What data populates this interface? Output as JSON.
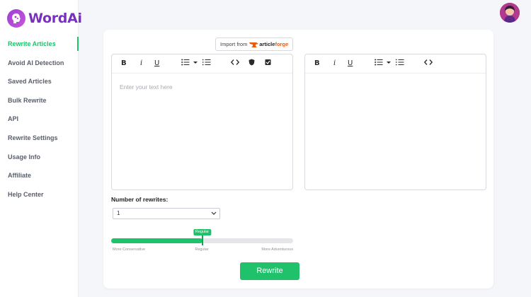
{
  "brand": {
    "name": "WordAi",
    "accent": "#20c16b",
    "brand_color": "#7b2fbe"
  },
  "sidebar": {
    "items": [
      {
        "label": "Rewrite Articles",
        "active": true
      },
      {
        "label": "Avoid AI Detection",
        "active": false
      },
      {
        "label": "Saved Articles",
        "active": false
      },
      {
        "label": "Bulk Rewrite",
        "active": false
      },
      {
        "label": "API",
        "active": false
      },
      {
        "label": "Rewrite Settings",
        "active": false
      },
      {
        "label": "Usage Info",
        "active": false
      },
      {
        "label": "Affiliate",
        "active": false
      },
      {
        "label": "Help Center",
        "active": false
      }
    ]
  },
  "import": {
    "prefix": "Import from",
    "brand_a": "article",
    "brand_b": "forge"
  },
  "editor_left": {
    "placeholder": "Enter your text here",
    "toolbar_icons": [
      "bold-icon",
      "italic-icon",
      "underline-icon",
      "bulleted-list-icon",
      "dropdown-caret-icon",
      "numbered-list-icon",
      "code-icon",
      "shield-icon",
      "check-box-icon"
    ]
  },
  "editor_right": {
    "toolbar_icons": [
      "bold-icon",
      "italic-icon",
      "underline-icon",
      "bulleted-list-icon",
      "dropdown-caret-icon",
      "numbered-list-icon",
      "code-icon"
    ]
  },
  "toolbar_glyphs": {
    "bold": "B",
    "italic": "i",
    "underline": "U"
  },
  "rewrites": {
    "label": "Number of rewrites:",
    "value": "1"
  },
  "slider": {
    "tag": "Regular",
    "position_fraction": 0.5,
    "labels": {
      "left": "More Conservative",
      "middle": "Regular",
      "right": "More Adventurous"
    }
  },
  "rewrite_button": "Rewrite"
}
